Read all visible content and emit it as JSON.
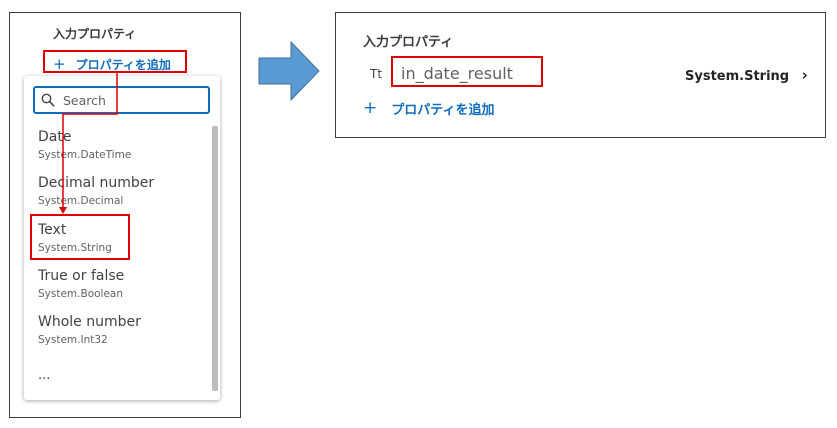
{
  "left_panel": {
    "heading": "入力プロパティ",
    "add_button": {
      "icon": "+",
      "label": "プロパティを追加"
    },
    "dropdown": {
      "search": {
        "placeholder": "Search",
        "value": ""
      },
      "items": [
        {
          "name": "Date",
          "type": "System.DateTime"
        },
        {
          "name": "Decimal number",
          "type": "System.Decimal"
        },
        {
          "name": "Text",
          "type": "System.String"
        },
        {
          "name": "True or false",
          "type": "System.Boolean"
        },
        {
          "name": "Whole number",
          "type": "System.Int32"
        }
      ],
      "more": "..."
    }
  },
  "right_panel": {
    "heading": "入力プロパティ",
    "property": {
      "type_icon": "Tt",
      "name": "in_date_result",
      "type": "System.String",
      "chevron": "›"
    },
    "add_button": {
      "icon": "+",
      "label": "プロパティを追加"
    }
  },
  "colors": {
    "highlight": "#e00000",
    "accent": "#0f6cbd",
    "arrow": "#5b9bd5"
  }
}
